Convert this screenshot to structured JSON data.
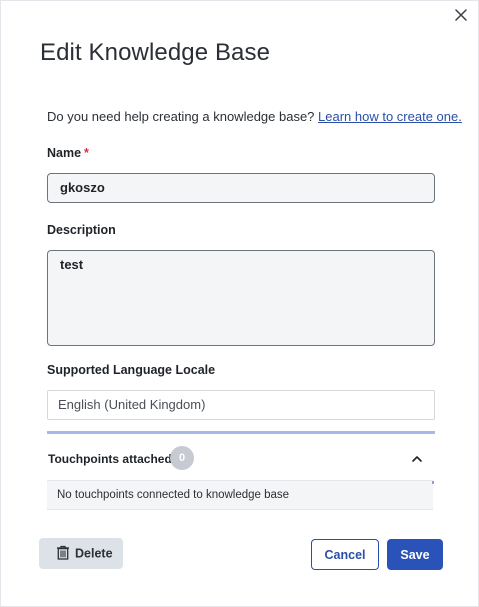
{
  "modal": {
    "title": "Edit Knowledge Base",
    "help_text": "Do you need help creating a knowledge base? ",
    "help_link": "Learn how to create one.",
    "close_icon": "close-icon"
  },
  "form": {
    "name_label": "Name",
    "name_required_marker": "*",
    "name_value": "gkoszo",
    "description_label": "Description",
    "description_value": "test",
    "locale_label": "Supported Language Locale",
    "locale_value": "English (United Kingdom)"
  },
  "touchpoints": {
    "title": "Touchpoints attached",
    "count": "0",
    "empty_message": "No touchpoints connected to knowledge base",
    "expanded": true
  },
  "actions": {
    "delete_label": "Delete",
    "cancel_label": "Cancel",
    "save_label": "Save"
  },
  "colors": {
    "primary": "#2a53b9",
    "link": "#2a4fa8",
    "required": "#d6313a",
    "badge": "#c7cad1"
  }
}
